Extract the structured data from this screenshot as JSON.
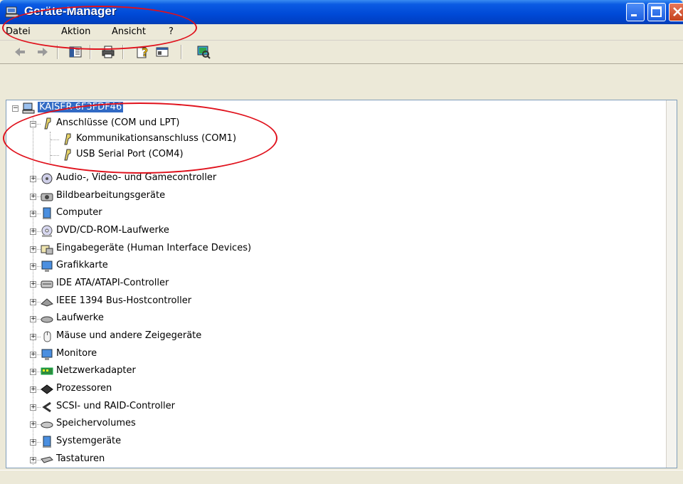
{
  "window": {
    "title": "Geräte-Manager",
    "title_icon": "device-manager-icon",
    "controls": [
      "minimize-icon",
      "maximize-icon",
      "close-icon"
    ]
  },
  "menu": {
    "items": [
      "Datei",
      "Aktion",
      "Ansicht",
      "?"
    ]
  },
  "toolbar": {
    "buttons": [
      "back-arrow-icon",
      "forward-arrow-icon",
      "console-tree-icon",
      "print-icon",
      "help-icon",
      "view-icon",
      "hardware-scan-icon"
    ]
  },
  "tree": {
    "root": {
      "label": "KAISER-6F3FDF46",
      "icon": "computer-icon",
      "expanded": true
    },
    "ports": {
      "label": "Anschlüsse (COM und LPT)",
      "icon": "port-plug-icon",
      "expanded": true,
      "children": [
        {
          "label": "Kommunikationsanschluss (COM1)",
          "icon": "port-plug-icon"
        },
        {
          "label": "USB Serial Port (COM4)",
          "icon": "port-plug-icon"
        }
      ]
    },
    "categories": [
      {
        "label": "Audio-, Video- und Gamecontroller",
        "icon": "audio-icon"
      },
      {
        "label": "Bildbearbeitungsgeräte",
        "icon": "camera-icon"
      },
      {
        "label": "Computer",
        "icon": "computer-icon"
      },
      {
        "label": "DVD/CD-ROM-Laufwerke",
        "icon": "dvd-icon"
      },
      {
        "label": "Eingabegeräte (Human Interface Devices)",
        "icon": "hid-icon"
      },
      {
        "label": "Grafikkarte",
        "icon": "display-adapter-icon"
      },
      {
        "label": "IDE ATA/ATAPI-Controller",
        "icon": "ide-controller-icon"
      },
      {
        "label": "IEEE 1394 Bus-Hostcontroller",
        "icon": "firewire-icon"
      },
      {
        "label": "Laufwerke",
        "icon": "drive-icon"
      },
      {
        "label": "Mäuse und andere Zeigegeräte",
        "icon": "mouse-icon"
      },
      {
        "label": "Monitore",
        "icon": "monitor-icon"
      },
      {
        "label": "Netzwerkadapter",
        "icon": "network-adapter-icon"
      },
      {
        "label": "Prozessoren",
        "icon": "processor-icon"
      },
      {
        "label": "SCSI- und RAID-Controller",
        "icon": "scsi-icon"
      },
      {
        "label": "Speichervolumes",
        "icon": "storage-volume-icon"
      },
      {
        "label": "Systemgeräte",
        "icon": "system-device-icon"
      },
      {
        "label": "Tastaturen",
        "icon": "keyboard-icon"
      }
    ]
  },
  "colors": {
    "titlebar": "#0049d6",
    "selection": "#316ac5",
    "annotation": "#e0111c"
  }
}
